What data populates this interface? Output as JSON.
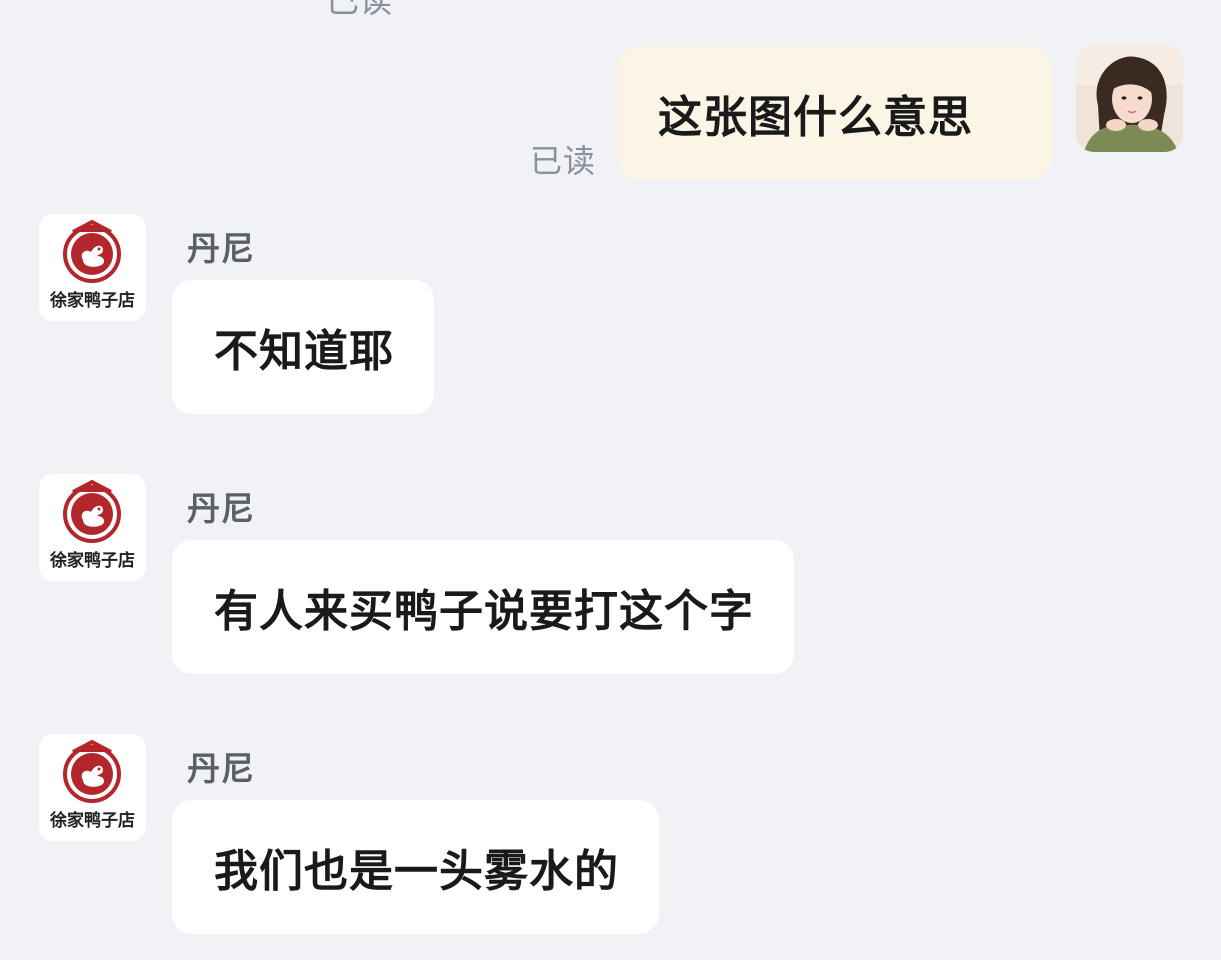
{
  "top_read_receipt": "已读",
  "outgoing": {
    "text": "这张图什么意思",
    "read_status": "已读"
  },
  "incoming_messages": [
    {
      "sender": "丹尼",
      "shop_logo_text": "徐家鸭子店",
      "text": "不知道耶"
    },
    {
      "sender": "丹尼",
      "shop_logo_text": "徐家鸭子店",
      "text": "有人来买鸭子说要打这个字"
    },
    {
      "sender": "丹尼",
      "shop_logo_text": "徐家鸭子店",
      "text": "我们也是一头雾水的"
    }
  ],
  "colors": {
    "background": "#f1f2f6",
    "outgoing_bubble": "#fbf5e6",
    "incoming_bubble": "#ffffff",
    "logo_red": "#b3262b"
  },
  "icons": {
    "user_avatar": "girl-portrait-avatar",
    "shop_avatar": "duck-shop-logo"
  }
}
